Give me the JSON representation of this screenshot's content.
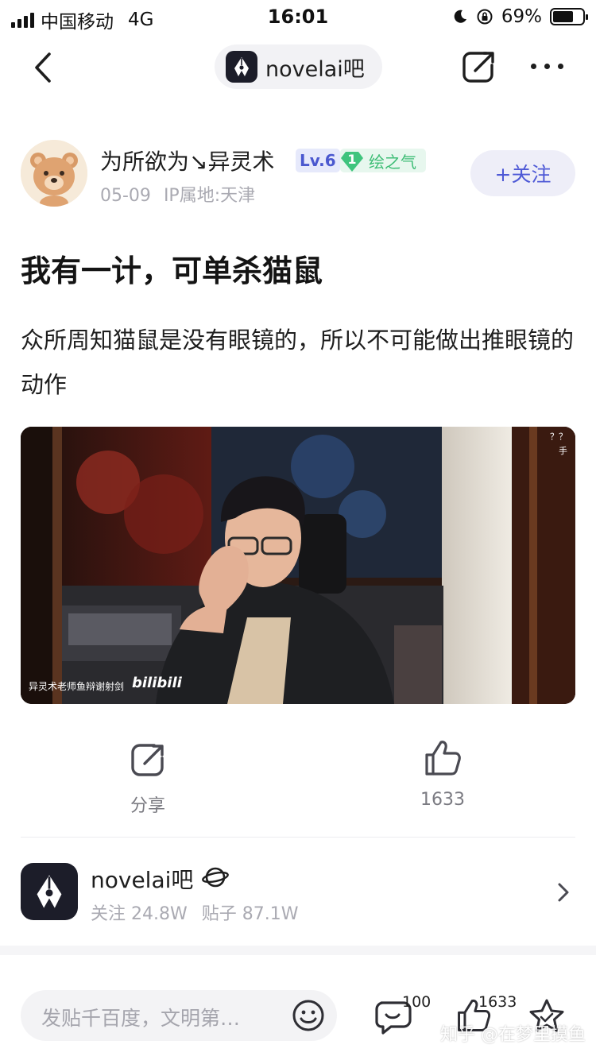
{
  "status_bar": {
    "carrier": "中国移动",
    "network": "4G",
    "time": "16:01",
    "battery": "69%",
    "battery_level": 0.69
  },
  "nav": {
    "forum_name": "novelai吧"
  },
  "post": {
    "author": {
      "name": "为所欲为↘异灵术",
      "level": "Lv.6",
      "badge_number": "1",
      "badge_text": "绘之气",
      "date": "05-09",
      "ip": "IP属地:天津",
      "follow_label": "+关注"
    },
    "title": "我有一计，可单杀猫鼠",
    "body": "众所周知猫鼠是没有眼镜的，所以不可能做出推眼镜的动作",
    "video": {
      "caption": "异灵术老师鱼辩谢射剑",
      "platform_logo": "bilibili",
      "corner_text_1": "？？",
      "corner_text_2": "手"
    }
  },
  "actions": {
    "share_label": "分享",
    "like_count": "1633"
  },
  "forum_card": {
    "name": "novelai吧",
    "followers": "关注 24.8W",
    "posts": "贴子 87.1W"
  },
  "bottom_bar": {
    "reply_placeholder": "发贴千百度，文明第…",
    "comment_count": "100",
    "like_count": "1633",
    "watermark": "知乎 @在梦里摸鱼"
  },
  "colors": {
    "accent": "#4e59d6",
    "level_badge_bg": "#e6e9fb",
    "green_badge": "#3dbd75",
    "muted_text": "#aaaab2",
    "forum_logo_bg": "#1c1d29"
  }
}
